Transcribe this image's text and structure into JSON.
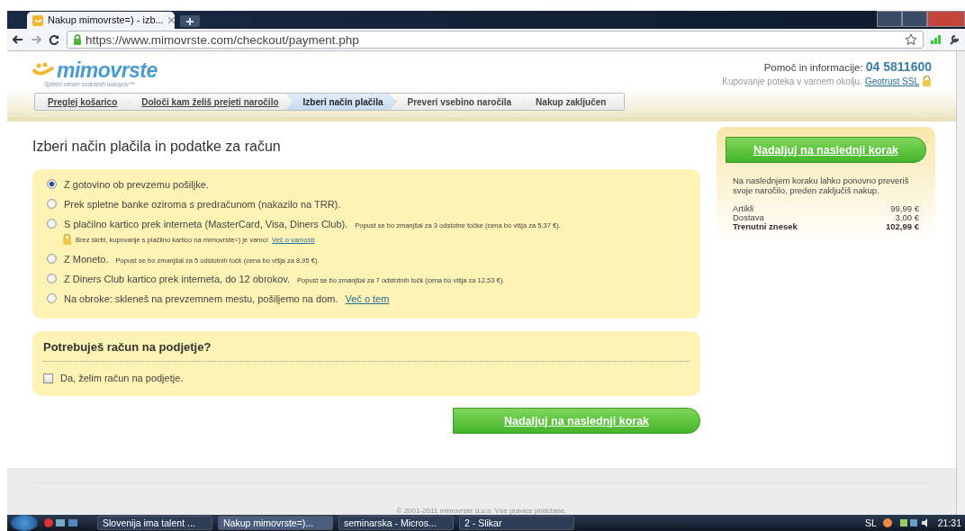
{
  "browser": {
    "tab_title": "Nakup mimovrste=) - izb...",
    "url": "https://www.mimovrste.com/checkout/payment.php"
  },
  "header": {
    "logo": "mimovrste",
    "tagline": "Spletni center sodobnih nakupov™",
    "help_label": "Pomoč in informacije:",
    "help_phone": "04 5811600",
    "secure_text": "Kupovanje poteka v varnem okolju.",
    "secure_link": "Geotrust SSL"
  },
  "steps": [
    {
      "label": "Preglej košarico",
      "selected": false,
      "completed": true
    },
    {
      "label": "Določi kam želiš prejeti naročilo",
      "selected": false,
      "completed": true
    },
    {
      "label": "Izberi način plačila",
      "selected": true,
      "completed": false
    },
    {
      "label": "Preveri vsebino naročila",
      "selected": false,
      "completed": false
    },
    {
      "label": "Nakup zaključen",
      "selected": false,
      "completed": false
    }
  ],
  "heading": "Izberi način plačila in podatke za račun",
  "payment_options": [
    {
      "label": "Z gotovino ob prevzemu pošiljke.",
      "selected": true
    },
    {
      "label": "Prek spletne banke oziroma s predračunom (nakazilo na TRR).",
      "selected": false
    },
    {
      "label": "S plačilno kartico prek interneta (MasterCard, Visa, Diners Club).",
      "note": "Popust se bo zmanjšal za 3 odstotne točke (cena bo višja za 5,37 €).",
      "selected": false,
      "secure_text": "Brez skrbi, kupovanje s plačilno kartico na mimovrste=) je varno!",
      "secure_link": "Več o varnosti"
    },
    {
      "label": "Z Moneto.",
      "note": "Popust se bo zmanjšal za 5 odstotnih točk (cena bo višja za 8,95 €).",
      "selected": false
    },
    {
      "label": "Z Diners Club kartico prek interneta, do 12 obrokov.",
      "note": "Popust se bo zmanjšal za 7 odstotnih točk (cena bo višja za 12,53 €).",
      "selected": false
    },
    {
      "label": "Na obroke: skleneš na prevzemnem mestu, pošiljemo na dom.",
      "link": "Več o tem",
      "selected": false
    }
  ],
  "company": {
    "title": "Potrebuješ račun na podjetje?",
    "checkbox_label": "Da, želim račun na podjetje.",
    "checked": false
  },
  "continue_button": "Nadaljuj na naslednji korak",
  "sidebar": {
    "button": "Nadaljuj na naslednji korak",
    "note": "Na naslednjem koraku lahko ponovno preveriš svoje naročilo, preden zaključiš nakup.",
    "totals": [
      {
        "label": "Artikli",
        "value": "99,99 €",
        "kind": "line"
      },
      {
        "label": "Dostava",
        "value": "3,00 €",
        "kind": "line"
      },
      {
        "label": "Trenutni znesek",
        "value": "102,99 €",
        "kind": "total"
      }
    ]
  },
  "footer": "© 2001-2011 mimovrste d.o.o. Vse pravice pridržane.",
  "taskbar": {
    "items": [
      {
        "label": "Slovenija ima talent ...",
        "selected": false
      },
      {
        "label": "Nakup mimovrste=)...",
        "selected": true
      },
      {
        "label": "seminarska - Micros...",
        "selected": false
      },
      {
        "label": "2 - Slikar",
        "selected": false
      }
    ],
    "language": "SL",
    "time": "21:31"
  }
}
